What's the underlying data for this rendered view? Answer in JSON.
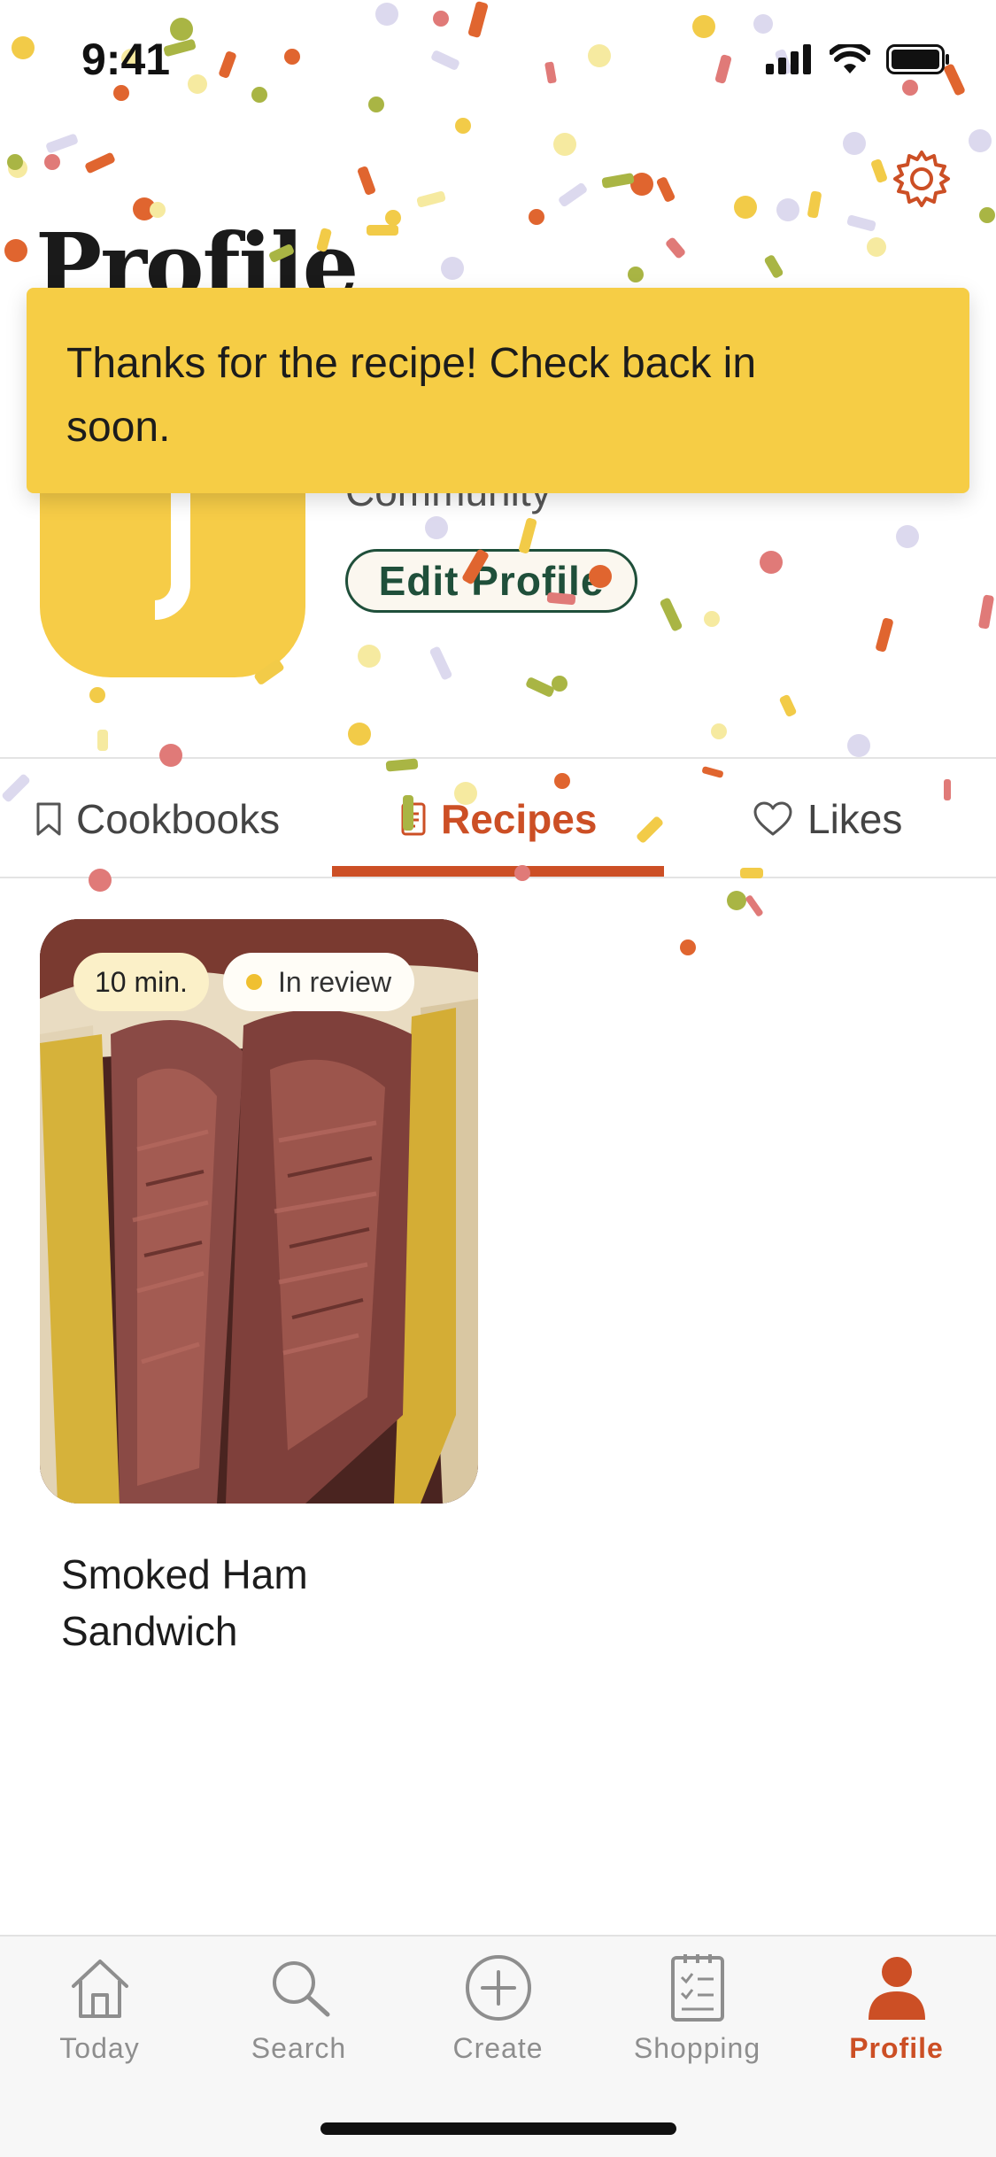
{
  "status_bar": {
    "time": "9:41"
  },
  "header": {
    "title": "Profile"
  },
  "profile": {
    "role": "Community",
    "edit_button": "Edit Profile"
  },
  "toast": {
    "message": "Thanks for the recipe! Check back in soon."
  },
  "tabs": [
    {
      "label": "Cookbooks",
      "icon": "bookmark-icon",
      "active": false
    },
    {
      "label": "Recipes",
      "icon": "recipe-card-icon",
      "active": true
    },
    {
      "label": "Likes",
      "icon": "heart-icon",
      "active": false
    }
  ],
  "recipes": [
    {
      "time": "10 min.",
      "status": "In review",
      "title": "Smoked Ham Sandwich"
    }
  ],
  "tab_bar": [
    {
      "label": "Today",
      "icon": "house-icon",
      "active": false
    },
    {
      "label": "Search",
      "icon": "magnifier-icon",
      "active": false
    },
    {
      "label": "Create",
      "icon": "plus-circle-icon",
      "active": false
    },
    {
      "label": "Shopping",
      "icon": "checklist-icon",
      "active": false
    },
    {
      "label": "Profile",
      "icon": "person-icon",
      "active": true
    }
  ],
  "colors": {
    "accent": "#cc4f25",
    "toast_bg": "#f6cd45",
    "avatar_bg": "#f6cc47",
    "edit_border": "#1f4f3a"
  }
}
